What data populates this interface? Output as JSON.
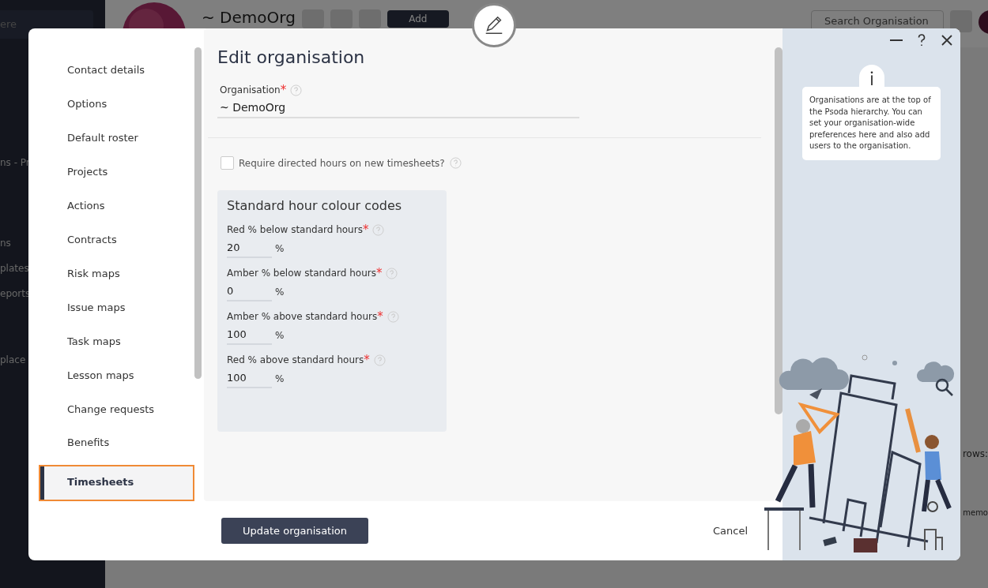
{
  "background": {
    "search_placeholder": "ere",
    "sidebar_items": [
      "ns - Pr",
      "ns",
      "plates",
      "eports",
      "place"
    ],
    "org_name": "~ DemoOrg",
    "add_button": "Add",
    "search_placeholder_right": "Search Organisation",
    "rows_label": "rows:",
    "memo": "memo"
  },
  "nav": [
    {
      "label": "Contact details",
      "selected": false
    },
    {
      "label": "Options",
      "selected": false
    },
    {
      "label": "Default roster",
      "selected": false
    },
    {
      "label": "Projects",
      "selected": false
    },
    {
      "label": "Actions",
      "selected": false
    },
    {
      "label": "Contracts",
      "selected": false
    },
    {
      "label": "Risk maps",
      "selected": false
    },
    {
      "label": "Issue maps",
      "selected": false
    },
    {
      "label": "Task maps",
      "selected": false
    },
    {
      "label": "Lesson maps",
      "selected": false
    },
    {
      "label": "Change requests",
      "selected": false
    },
    {
      "label": "Benefits",
      "selected": false
    },
    {
      "label": "Timesheets",
      "selected": true
    }
  ],
  "title": "Edit organisation",
  "organisation": {
    "label": "Organisation",
    "required_mark": "*",
    "value": "~ DemoOrg"
  },
  "checkbox": {
    "label": "Require directed hours on new timesheets?",
    "checked": false
  },
  "card": {
    "title": "Standard hour colour codes",
    "fields": [
      {
        "label": "Red % below standard hours",
        "required_mark": "*",
        "value": "20",
        "unit": "%"
      },
      {
        "label": "Amber % below standard hours",
        "required_mark": "*",
        "value": "0",
        "unit": "%"
      },
      {
        "label": "Amber % above standard hours",
        "required_mark": "*",
        "value": "100",
        "unit": "%"
      },
      {
        "label": "Red % above standard hours",
        "required_mark": "*",
        "value": "100",
        "unit": "%"
      }
    ]
  },
  "info": "Organisations are at the top of the Psoda hierarchy. You can set your organisation-wide preferences here and also add users to the organisation.",
  "update_button": "Update organisation",
  "cancel_button": "Cancel"
}
